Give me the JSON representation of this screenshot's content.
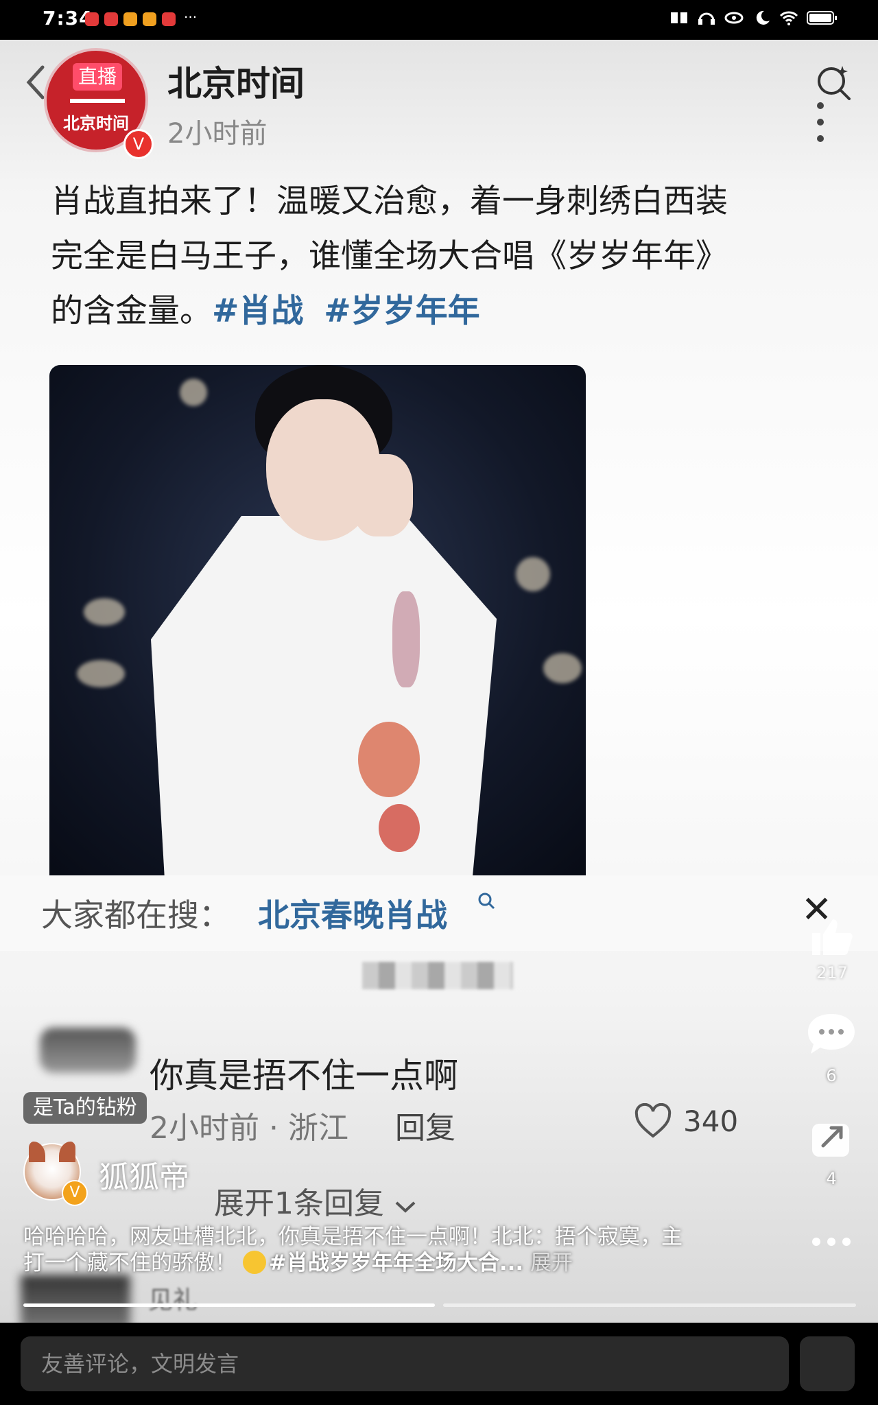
{
  "status_bar": {
    "time": "7:34",
    "notif_more": "···"
  },
  "post": {
    "avatar_tag": "直播",
    "avatar_name": "北京时间",
    "avatar_v": "V",
    "author": "北京时间",
    "time": "2小时前",
    "text_line1": "肖战直拍来了！温暖又治愈，着一身刺绣白西装",
    "text_line2": "完全是白马王子，谁懂全场大合唱《岁岁年年》",
    "text_line3": "的含金量。",
    "hashtag1": "#肖战",
    "hashtag2": "#岁岁年年"
  },
  "trend": {
    "label": "大家都在搜：",
    "link": "北京春晚肖战",
    "close": "✕"
  },
  "comment": {
    "text": "你真是捂不住一点啊",
    "meta": "2小时前 · 浙江",
    "reply": "回复",
    "likes": "340",
    "expand": "展开1条回复",
    "faded": "见礼"
  },
  "side": {
    "like_count": "217",
    "comment_count": "6",
    "share_count": "4"
  },
  "overlay": {
    "fan_badge": "是Ta的钻粉",
    "op_name": "狐狐帝",
    "op_v": "V",
    "caption_a": "哈哈哈哈，网友吐槽北北，你真是捂不住一点啊！北北：捂个寂寞，主打一个藏不住的骄傲！",
    "caption_tag": "#肖战岁岁年年全场大合...",
    "caption_expand": "展开"
  },
  "input": {
    "placeholder": "友善评论，文明发言"
  }
}
